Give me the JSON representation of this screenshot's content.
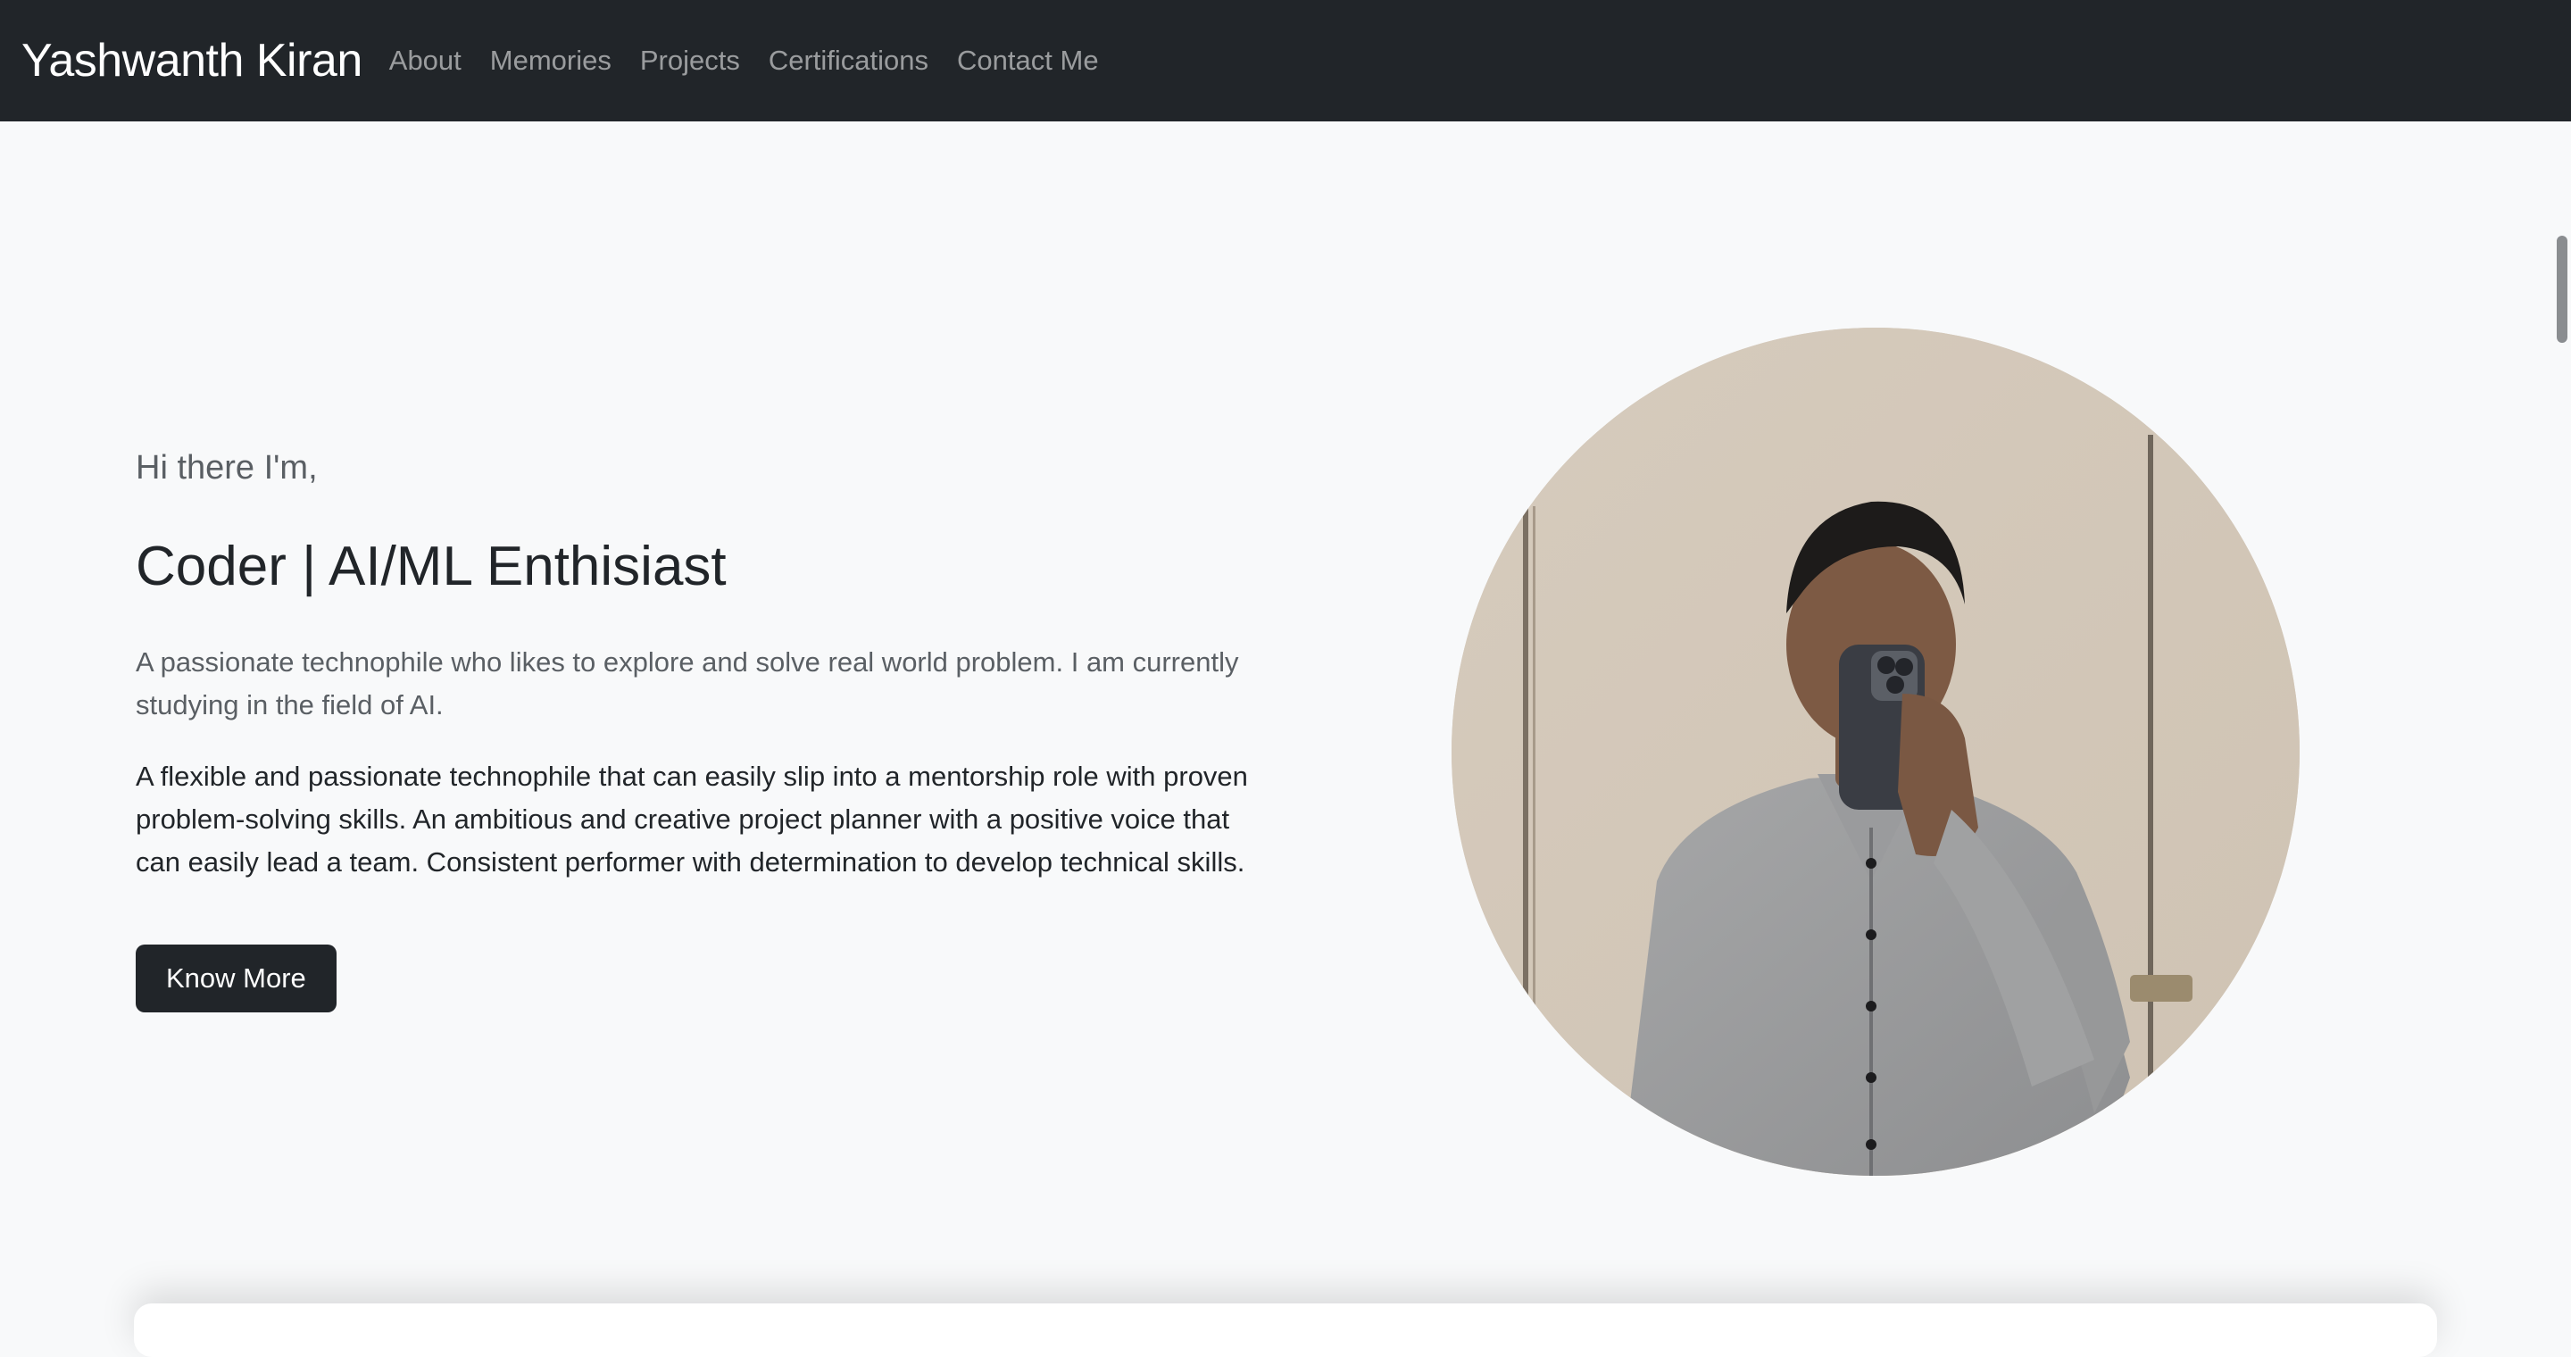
{
  "navbar": {
    "brand": "Yashwanth Kiran",
    "links": [
      "About",
      "Memories",
      "Projects",
      "Certifications",
      "Contact Me"
    ]
  },
  "hero": {
    "greeting": "Hi there I'm,",
    "headline": "Coder | AI/ML Enthisiast",
    "lead": "A passionate technophile who likes to explore and solve real world problem. I am currently studying in the field of AI.",
    "body": "A flexible and passionate technophile that can easily slip into a mentorship role with proven problem-solving skills. An ambitious and creative project planner with a positive voice that can easily lead a team. Consistent performer with determination to develop technical skills.",
    "button_label": "Know More"
  },
  "colors": {
    "navbar_bg": "#212529",
    "page_bg": "#f8f9fa",
    "button_bg": "#212529",
    "muted_text": "#5a5f64"
  },
  "icons": {
    "profile_photo": "profile-photo"
  }
}
